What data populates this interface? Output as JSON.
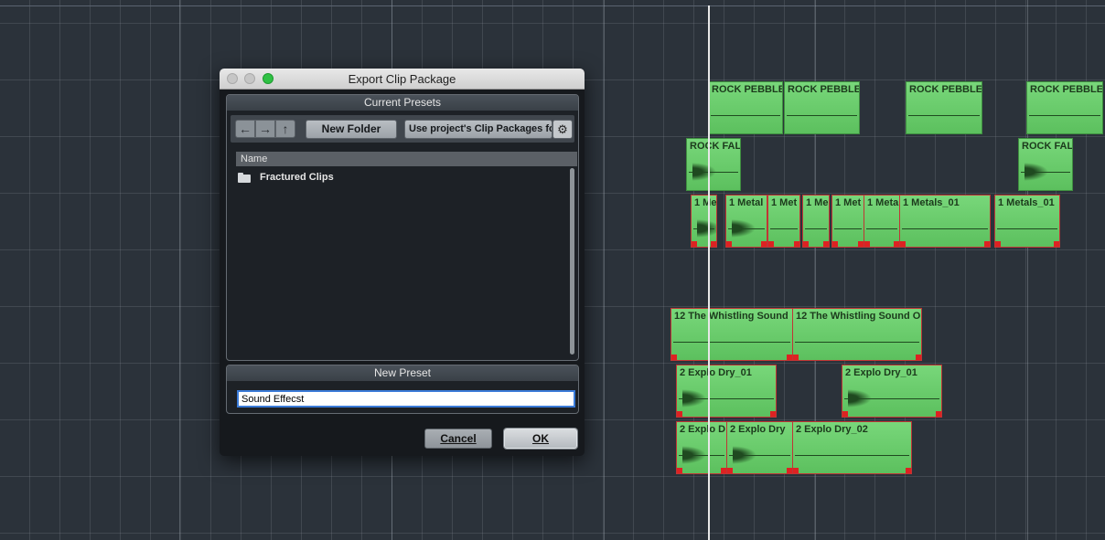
{
  "dialog": {
    "title": "Export Clip Package",
    "presets_header": "Current Presets",
    "new_folder_label": "New Folder",
    "location_value": "Use project's Clip Packages fo",
    "column_name": "Name",
    "items": [
      {
        "name": "Fractured Clips",
        "icon": "folder-icon"
      }
    ],
    "new_preset_header": "New Preset",
    "preset_input_value": "Sound Effecst",
    "cancel_label": "Cancel",
    "ok_label": "OK",
    "icons": {
      "back": "arrow-left-icon",
      "forward": "arrow-right-icon",
      "up": "arrow-up-icon",
      "settings": "gear-icon"
    }
  },
  "clips": [
    {
      "name": "ROCK PEBBLE",
      "selected": false
    },
    {
      "name": "ROCK PEBBLE",
      "selected": false
    },
    {
      "name": "ROCK PEBBLE",
      "selected": false
    },
    {
      "name": "ROCK PEBBLE",
      "selected": false
    },
    {
      "name": "ROCK FAL",
      "selected": false
    },
    {
      "name": "ROCK FAL",
      "selected": false
    },
    {
      "name": "1 Me",
      "selected": true
    },
    {
      "name": "1 Metal",
      "selected": true
    },
    {
      "name": "1 Met",
      "selected": true
    },
    {
      "name": "1 Me",
      "selected": true
    },
    {
      "name": "1 Met",
      "selected": true
    },
    {
      "name": "1 Meta",
      "selected": true
    },
    {
      "name": "1 Metals_01",
      "selected": true
    },
    {
      "name": "1 Metals_01",
      "selected": true
    },
    {
      "name": "12 The Whistling Sound",
      "selected": true
    },
    {
      "name": "12 The Whistling Sound O",
      "selected": true
    },
    {
      "name": "2 Explo Dry_01",
      "selected": true
    },
    {
      "name": "2 Explo Dry_01",
      "selected": true
    },
    {
      "name": "2 Explo D",
      "selected": true
    },
    {
      "name": "2 Explo Dry",
      "selected": true
    },
    {
      "name": "2 Explo Dry_02",
      "selected": true
    }
  ],
  "colors": {
    "clip_green": "#66c968",
    "selection_red": "#c03535",
    "background": "#2b323a",
    "accent_blue": "#3b7bd8",
    "zoom_green": "#2fc144"
  }
}
